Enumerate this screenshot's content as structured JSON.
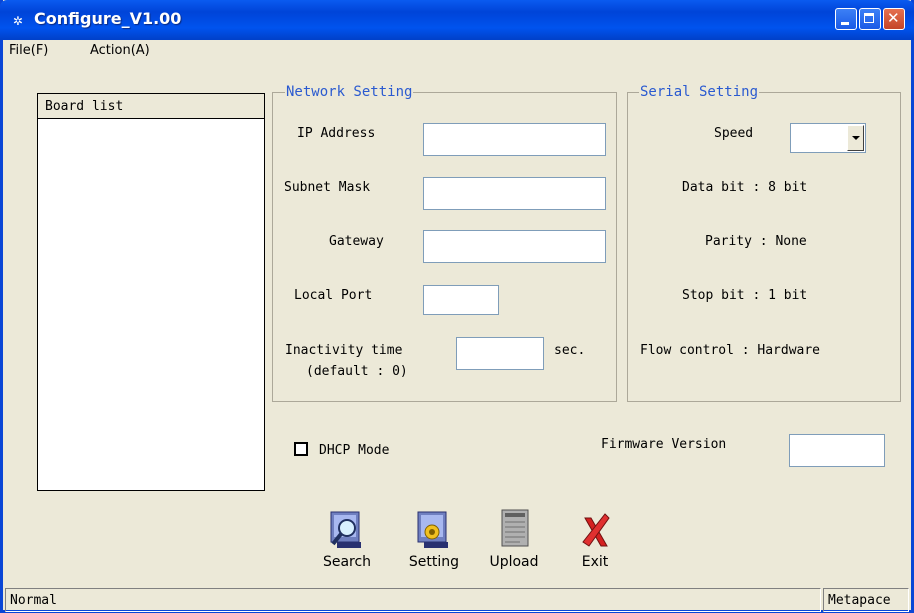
{
  "window": {
    "title": "Configure_V1.00"
  },
  "menu": {
    "file": "File(F)",
    "action": "Action(A)"
  },
  "board_list": {
    "header": "Board list",
    "items": []
  },
  "network": {
    "title": "Network Setting",
    "ip_label": "IP Address",
    "ip_value": "",
    "subnet_label": "Subnet Mask",
    "subnet_value": "",
    "gateway_label": "Gateway",
    "gateway_value": "",
    "port_label": "Local Port",
    "port_value": "",
    "inactivity_label": "Inactivity time",
    "inactivity_default": "(default : 0)",
    "inactivity_value": "",
    "inactivity_unit": "sec."
  },
  "serial": {
    "title": "Serial Setting",
    "speed_label": "Speed",
    "speed_value": "",
    "data_bit": "Data bit : 8 bit",
    "parity": "Parity : None",
    "stop_bit": "Stop bit : 1 bit",
    "flow_control": "Flow control : Hardware"
  },
  "dhcp": {
    "label": "DHCP Mode",
    "checked": false
  },
  "firmware": {
    "label": "Firmware Version",
    "value": ""
  },
  "toolbar": {
    "search": "Search",
    "setting": "Setting",
    "upload": "Upload",
    "exit": "Exit"
  },
  "status": {
    "left": "Normal",
    "right": "Metapace"
  },
  "colors": {
    "titlebar": "#0053ee",
    "group_title": "#2a5ad0",
    "face": "#ece9d8",
    "exit_red": "#d42020"
  }
}
